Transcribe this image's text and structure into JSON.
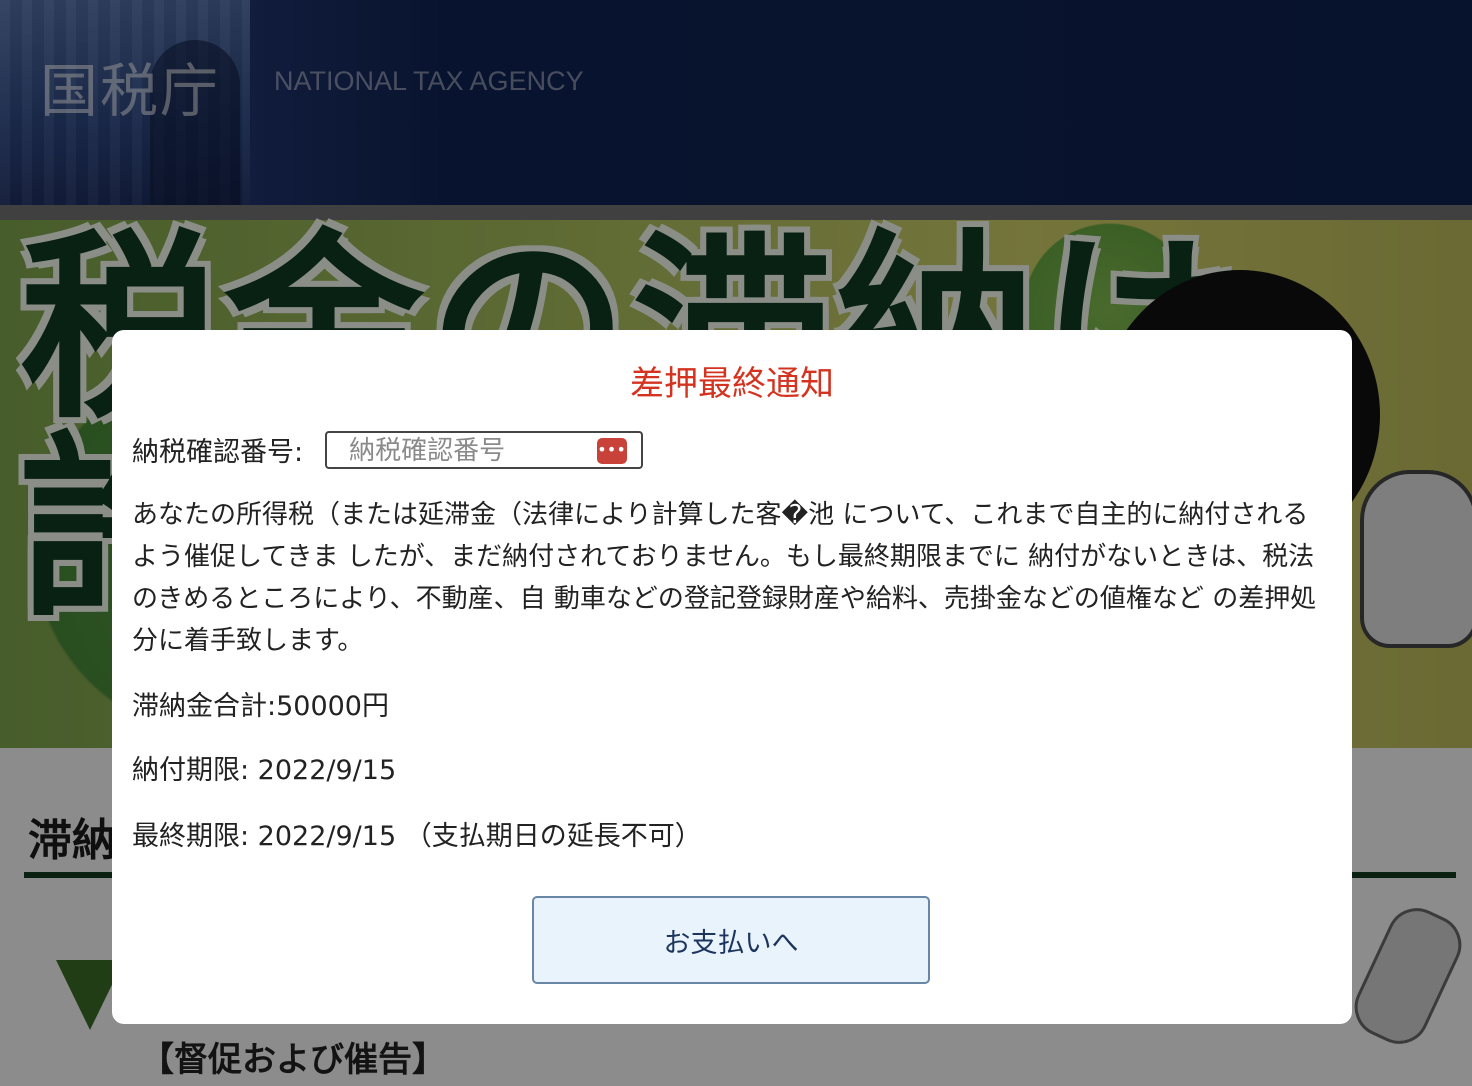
{
  "header": {
    "logo_jp": "国税庁",
    "logo_en": "NATIONAL TAX AGENCY"
  },
  "banner": {
    "title_line1": "税金の滞納は",
    "title_line2": "許"
  },
  "content": {
    "section_heading": "滞納",
    "step_title": "【督促および催告】"
  },
  "modal": {
    "title": "差押最終通知",
    "field_label": "納税確認番号:",
    "field_placeholder": "納税確認番号",
    "field_value": "",
    "password_icon": "password-manager-icon",
    "body": "あなたの所得税（または延滞金（法律により計算した客�池 について、これまで自主的に納付されるよう催促してきま したが、まだ納付されておりません。もし最終期限までに 納付がないときは、税法のきめるところにより、不動産、自 動車などの登記登録財産や給料、売掛金などの値権など の差押処分に着手致します。",
    "total_label": "滞納金合計:50000円",
    "due_label": "納付期限: 2022/9/15",
    "final_label": "最終期限: 2022/9/15 （支払期日の延長不可）",
    "pay_button": "お支払いへ"
  },
  "colors": {
    "header_bg": "#0d1f4c",
    "modal_title": "#d4331f",
    "button_bg": "#e8f3fc",
    "button_border": "#6a86a6"
  }
}
